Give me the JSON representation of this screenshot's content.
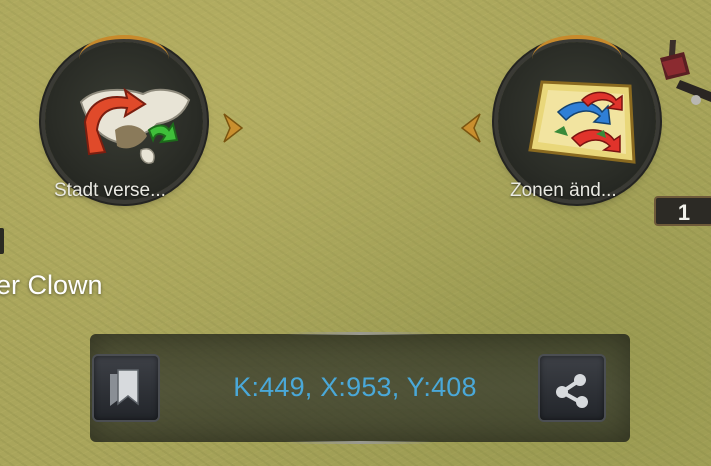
{
  "left_action": {
    "label": "Stadt verse...",
    "icon": "relocate-city-map-icon"
  },
  "right_action": {
    "label": "Zonen änd...",
    "icon": "change-zone-map-icon"
  },
  "chevrons": {
    "right": "chevron-right-icon",
    "left": "chevron-left-icon"
  },
  "player": {
    "name": "er Clown"
  },
  "coordinates": {
    "text": "K:449, X:953, Y:408"
  },
  "bookmark_button": {
    "icon": "bookmark-icon"
  },
  "share_button": {
    "icon": "share-icon"
  },
  "level_badge": {
    "value": "1"
  },
  "colors": {
    "accent_gold": "#c78a2c",
    "coords_blue": "#4aa8d8",
    "grass": "#a9a55b"
  }
}
